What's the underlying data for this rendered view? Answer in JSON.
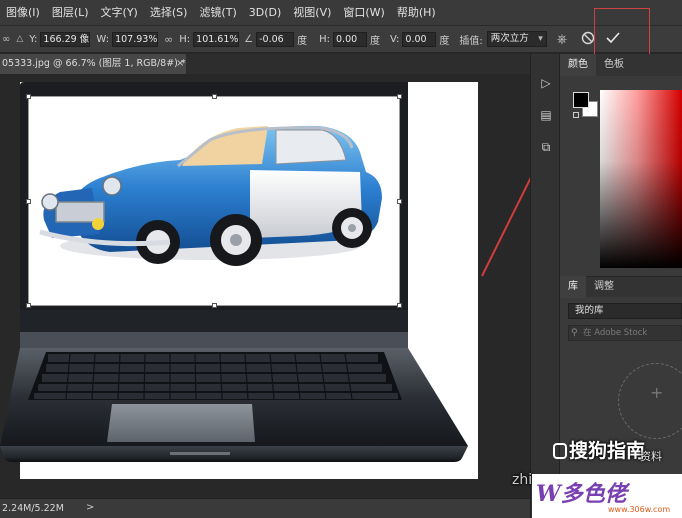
{
  "menubar": {
    "items": [
      "图像(I)",
      "图层(L)",
      "文字(Y)",
      "选择(S)",
      "滤镜(T)",
      "3D(D)",
      "视图(V)",
      "窗口(W)",
      "帮助(H)"
    ]
  },
  "options": {
    "y_label": "Y:",
    "y_value": "166.29 像",
    "w_label": "W:",
    "w_value": "107.93%",
    "h_label": "H:",
    "h_value": "101.61%",
    "angle_value": "-0.06",
    "angle_unit": "度",
    "hskew_label": "H:",
    "hskew_value": "0.00",
    "hskew_unit": "度",
    "vskew_label": "V:",
    "vskew_value": "0.00",
    "vskew_unit": "度",
    "interp_label": "插值:",
    "interp_value": "两次立方"
  },
  "document": {
    "tab_title": "05333.jpg @ 66.7% (图层 1, RGB/8#) *",
    "close_glyph": "×"
  },
  "status": {
    "doc_size": "2.24M/5.22M",
    "arrow": ">"
  },
  "panels": {
    "color_tabs": [
      "颜色",
      "色板"
    ],
    "library_tabs": [
      "库",
      "调整"
    ],
    "library_name": "我的库",
    "search_placeholder": "在 Adobe Stock",
    "plus": "+"
  },
  "watermarks": {
    "sogou": "搜狗指南",
    "zhi": "zhi",
    "zi_liao": "资料",
    "site_logo": "W多色佬",
    "site_url": "www.306w.com"
  },
  "colors": {
    "annotation_red": "#d04040",
    "accent_blue": "#2c7fd0"
  }
}
